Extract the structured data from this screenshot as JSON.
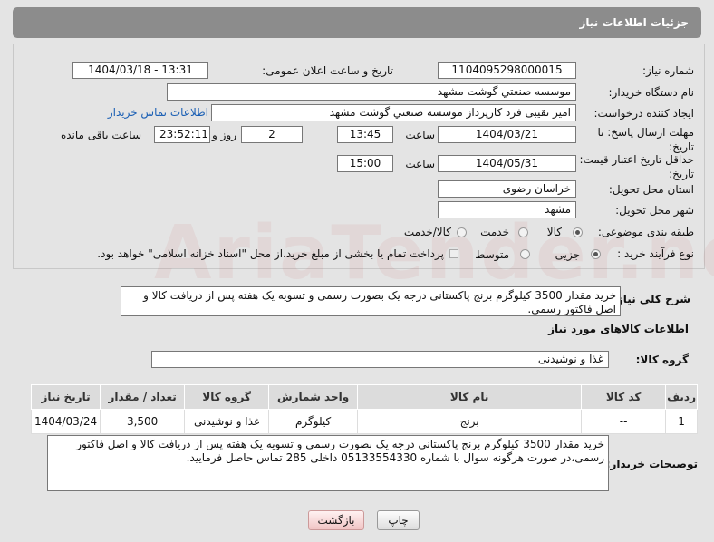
{
  "header": {
    "title": "جزئیات اطلاعات نیاز"
  },
  "form": {
    "need_number_label": "شماره نیاز:",
    "need_number": "1104095298000015",
    "announce_label": "تاریخ و ساعت اعلان عمومی:",
    "announce_value": "1404/03/18 - 13:31",
    "buyer_org_label": "نام دستگاه خریدار:",
    "buyer_org": "موسسه صنعتي گوشت مشهد",
    "creator_label": "ایجاد کننده درخواست:",
    "creator": "امیر نقیبی فرد کارپرداز موسسه صنعتي گوشت مشهد",
    "contact_link": "اطلاعات تماس خریدار",
    "reply_deadline_label": "مهلت ارسال پاسخ: تا تاریخ:",
    "reply_date": "1404/03/21",
    "time_label": "ساعت",
    "reply_time": "13:45",
    "days_value": "2",
    "days_label": "روز و",
    "remaining_time": "23:52:11",
    "remaining_label": "ساعت باقی مانده",
    "price_validity_label": "حداقل تاریخ اعتبار قیمت: تا تاریخ:",
    "price_date": "1404/05/31",
    "price_time": "15:00",
    "province_label": "استان محل تحویل:",
    "province": "خراسان رضوی",
    "city_label": "شهر محل تحویل:",
    "city": "مشهد",
    "category_label": "طبقه بندی موضوعی:",
    "category_options": [
      "کالا",
      "خدمت",
      "کالا/خدمت"
    ],
    "category_selected": "کالا",
    "process_label": "نوع فرآیند خرید :",
    "process_options": [
      "جزیی",
      "متوسط"
    ],
    "process_selected": "جزیی",
    "payment_note": "پرداخت تمام یا بخشی از مبلغ خرید،از محل \"اسناد خزانه اسلامی\" خواهد بود."
  },
  "description": {
    "label": "شرح کلی نیاز:",
    "text": "خرید مقدار 3500 کیلوگرم برنج پاکستانی درجه یک بصورت رسمی و تسویه یک هفته پس از دریافت کالا و اصل فاکتور رسمی."
  },
  "goods": {
    "section_title": "اطلاعات کالاهای مورد نیاز",
    "group_label": "گروه کالا:",
    "group_value": "غذا و نوشیدنی",
    "columns": [
      "ردیف",
      "کد کالا",
      "نام کالا",
      "واحد شمارش",
      "گروه کالا",
      "تعداد / مقدار",
      "تاریخ نیاز"
    ],
    "rows": [
      [
        "1",
        "--",
        "برنج",
        "کیلوگرم",
        "غذا و نوشیدنی",
        "3,500",
        "1404/03/24"
      ]
    ]
  },
  "buyer_notes": {
    "label": "توضیحات خریدار:",
    "text": "خرید مقدار 3500 کیلوگرم برنج پاکستانی درجه یک بصورت رسمی و تسویه یک هفته پس از دریافت کالا و اصل فاکتور رسمی،در صورت هرگونه سوال با شماره 05133554330 داخلی 285 تماس حاصل فرمایید."
  },
  "buttons": {
    "print": "چاپ",
    "back": "بازگشت"
  },
  "colors": {
    "header_bg": "#8c8c8c",
    "link": "#1a5fb4",
    "back_button": "#f1c5c5"
  }
}
